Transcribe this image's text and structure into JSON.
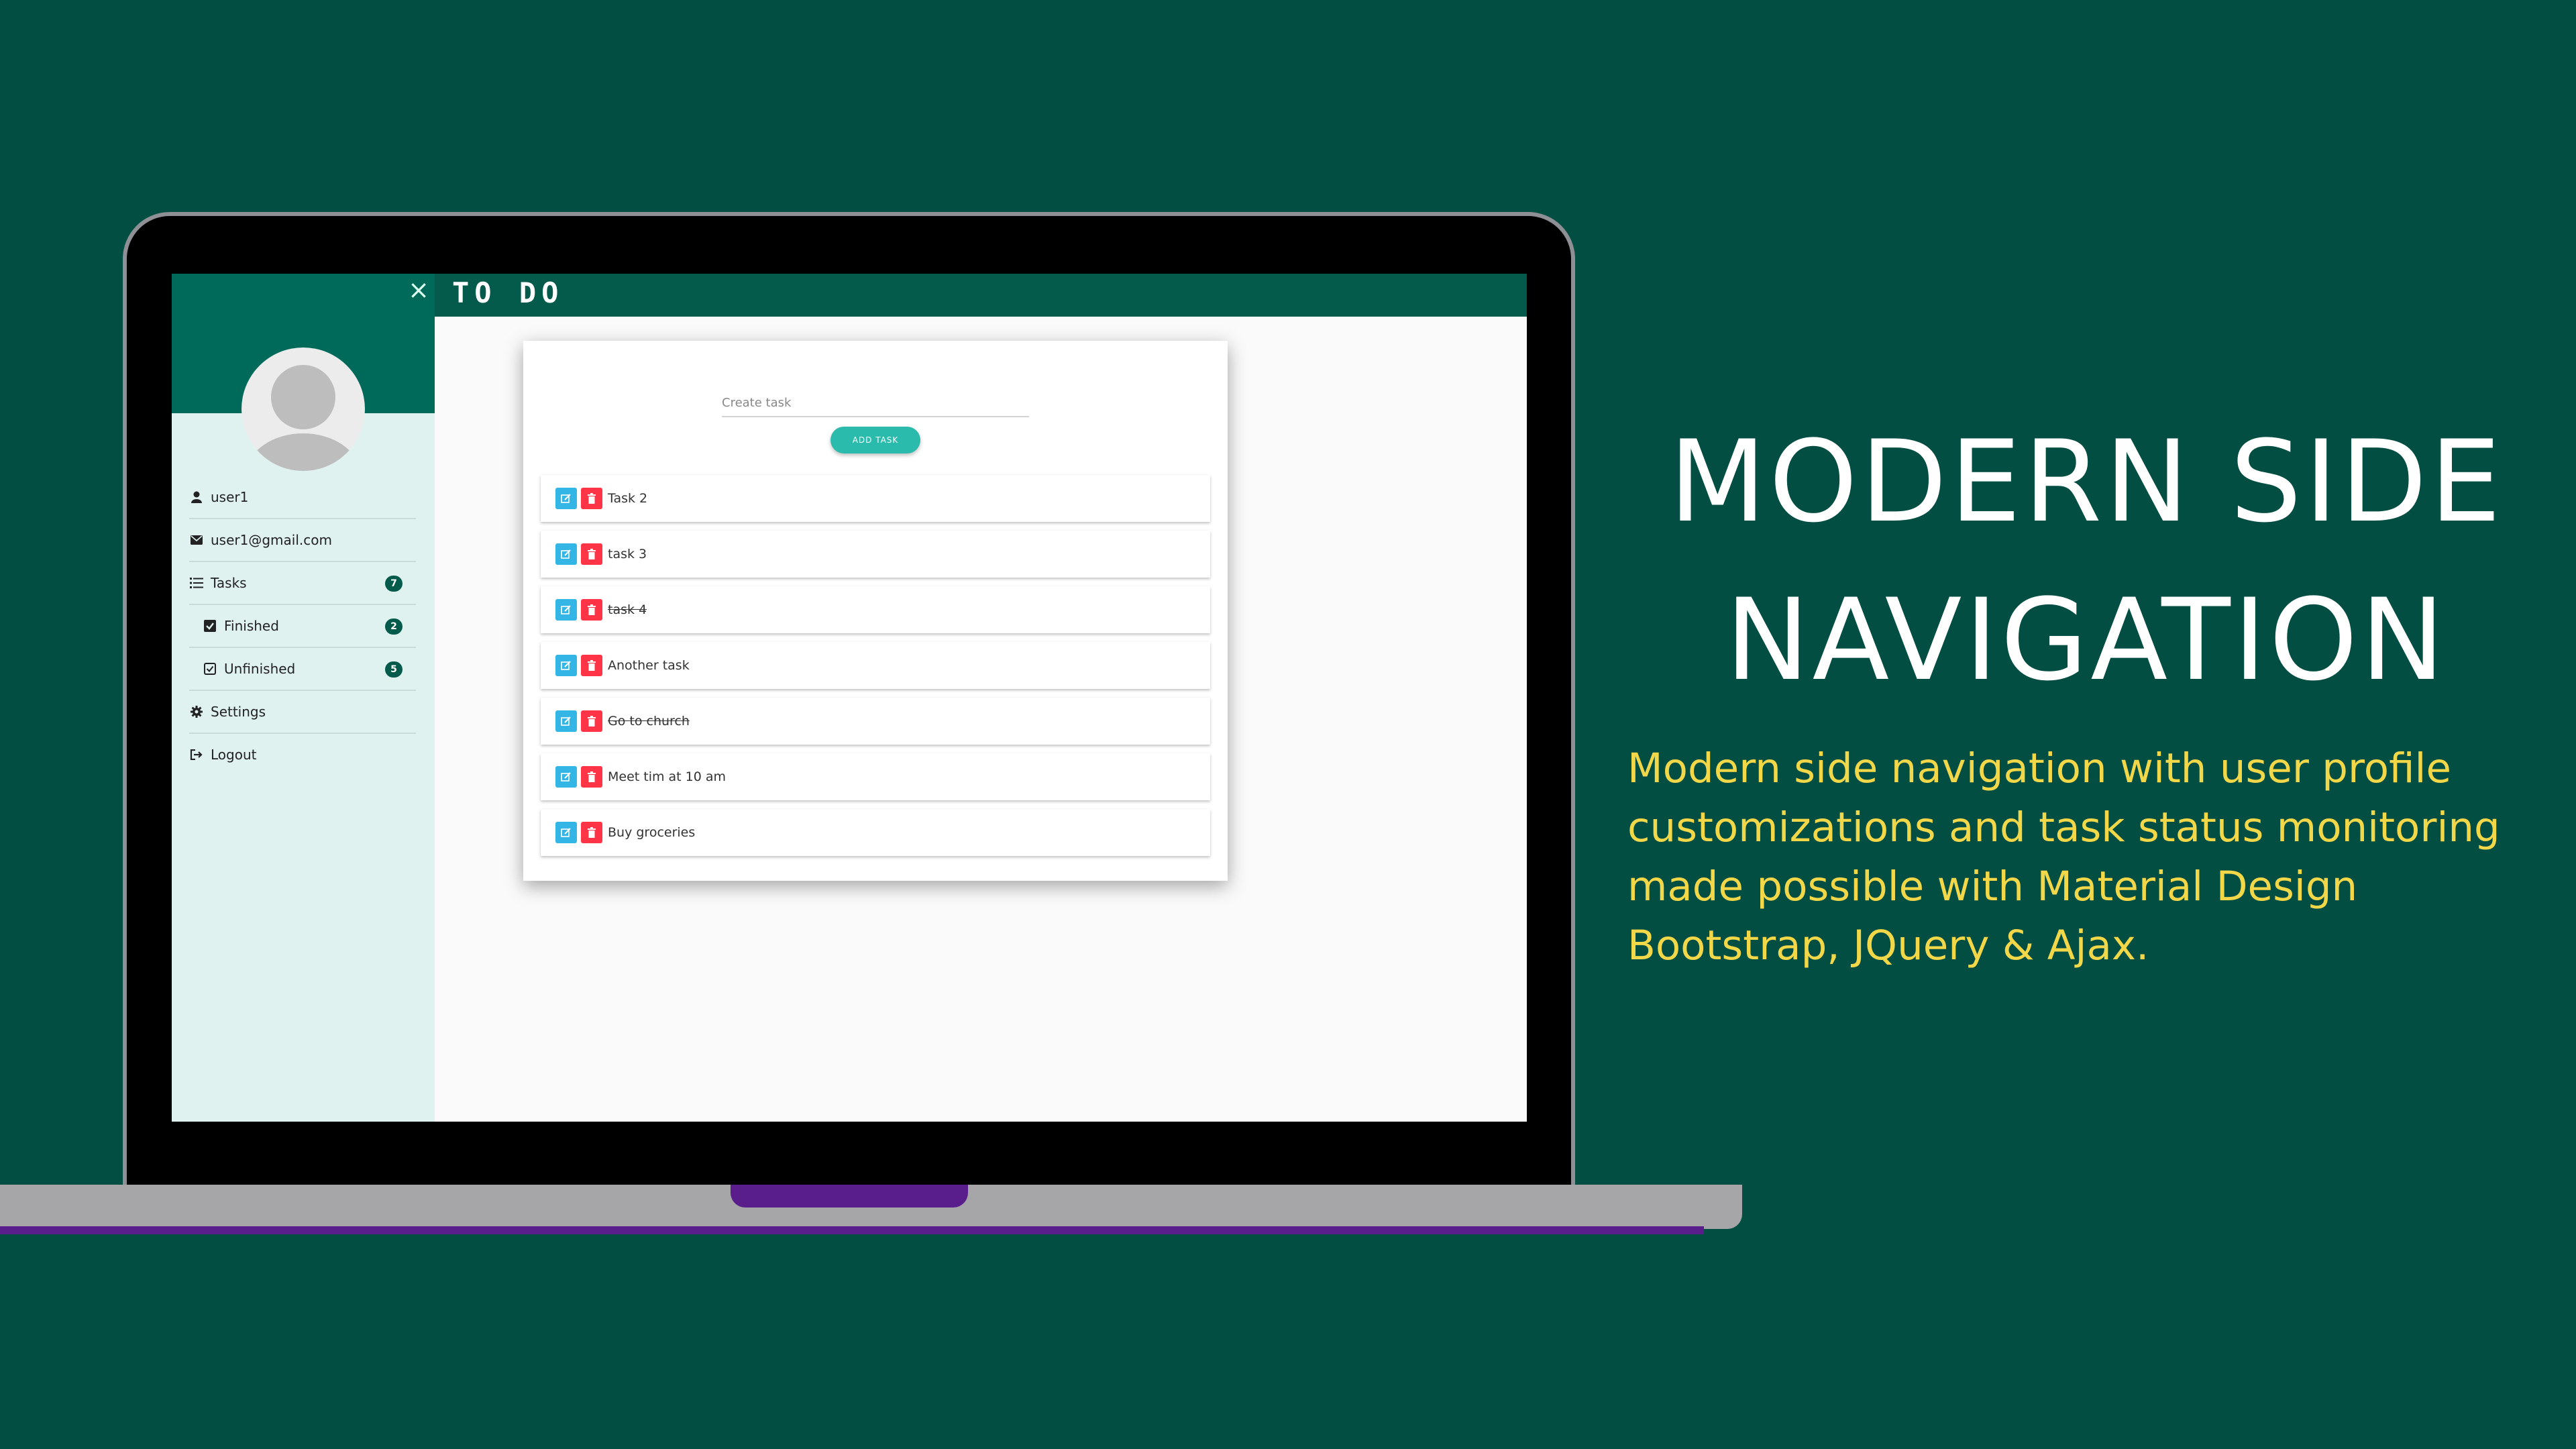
{
  "headline": [
    "MODERN SIDE",
    "NAVIGATION"
  ],
  "description": "Modern side navigation with user profile customizations and task status monitoring made possible with Material Design Bootstrap, JQuery & Ajax.",
  "app": {
    "title": "TO DO",
    "close_icon": "×",
    "user": {
      "name": "user1",
      "email": "user1@gmail.com"
    },
    "menu": {
      "tasks": {
        "label": "Tasks",
        "count": "7",
        "icon": "list-icon"
      },
      "finished": {
        "label": "Finished",
        "count": "2",
        "icon": "checkbox-checked-icon"
      },
      "unfinished": {
        "label": "Unfinished",
        "count": "5",
        "icon": "checkbox-outline-icon"
      },
      "settings": {
        "label": "Settings",
        "icon": "gear-icon"
      },
      "logout": {
        "label": "Logout",
        "icon": "sign-out-icon"
      }
    },
    "task_input": {
      "placeholder": "Create task",
      "value": ""
    },
    "add_button": "ADD TASK",
    "tasks": [
      {
        "text": "Task 2",
        "done": false
      },
      {
        "text": "task 3",
        "done": false
      },
      {
        "text": "task 4",
        "done": true
      },
      {
        "text": "Another task",
        "done": false
      },
      {
        "text": "Go to church",
        "done": true
      },
      {
        "text": "Meet tim at 10 am",
        "done": false
      },
      {
        "text": "Buy groceries",
        "done": false
      }
    ]
  },
  "colors": {
    "background": "#034E42",
    "header": "#045A4B",
    "accent": "#2BBBAD",
    "edit": "#33B5E5",
    "delete": "#FF3547",
    "description_text": "#F2D749"
  }
}
